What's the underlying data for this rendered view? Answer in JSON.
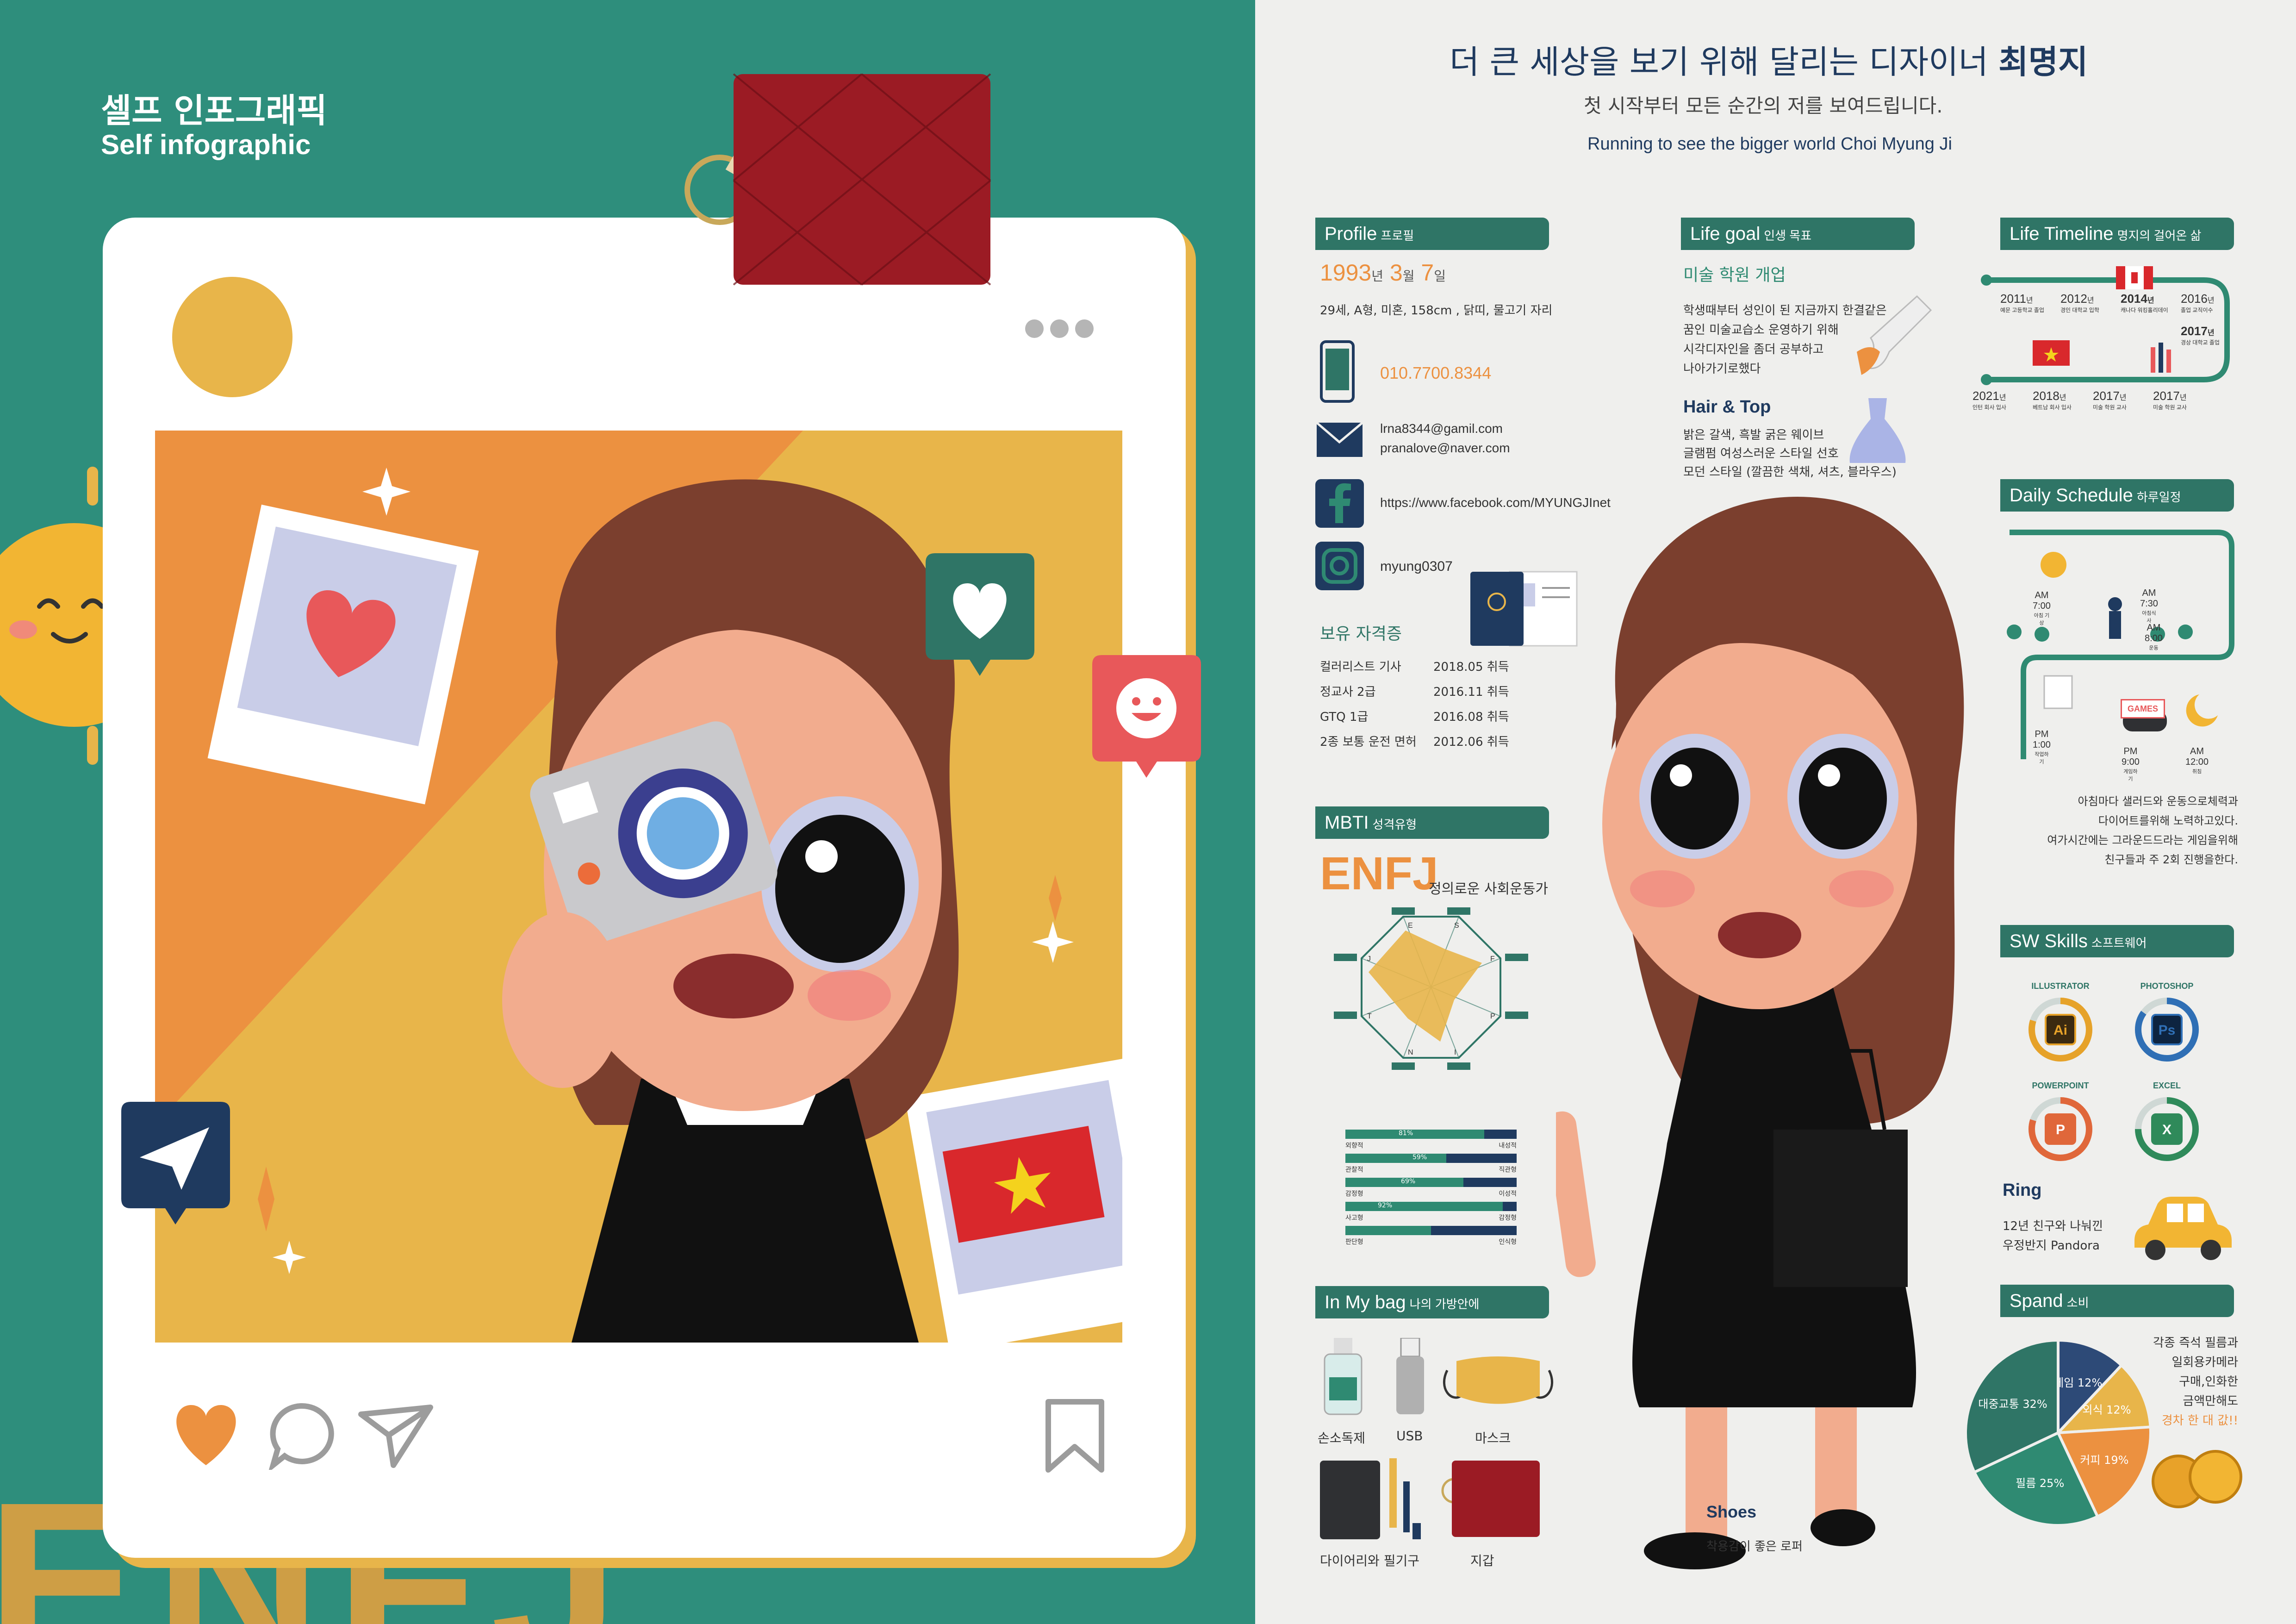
{
  "left": {
    "title_ko": "셀프 인포그래픽",
    "title_en": "Self infographic",
    "bg_text": "ENFJ"
  },
  "header": {
    "title_main": "더 큰 세상을 보기 위해 달리는 디자이너",
    "title_name": "최명지",
    "subtitle_ko": "첫 시작부터 모든 순간의 저를 보여드립니다.",
    "subtitle_en": "Running to see the bigger world Choi Myung Ji"
  },
  "profile": {
    "heading": "Profile",
    "heading_sub": "프로필",
    "birth": {
      "year": "1993",
      "year_unit": "년",
      "month": "3",
      "month_unit": "월",
      "day": "7",
      "day_unit": "일"
    },
    "details": "29세, A형, 미혼, 158cm , 닭띠, 물고기 자리",
    "phone": "010.7700.8344",
    "email1": "lrna8344@gamil.com",
    "email2": "pranalove@naver.com",
    "facebook": "https://www.facebook.com/MYUNGJInet",
    "instagram": "myung0307",
    "cert_heading": "보유 자격증",
    "certs": [
      {
        "name": "컬러리스트 기사",
        "date": "2018.05 취득"
      },
      {
        "name": "정교사 2급",
        "date": "2016.11 취득"
      },
      {
        "name": "GTQ 1급",
        "date": "2016.08 취득"
      },
      {
        "name": "2종 보통 운전 면허",
        "date": "2012.06 취득"
      }
    ]
  },
  "mbti": {
    "heading": "MBTI",
    "heading_sub": "성격유형",
    "type": "ENFJ",
    "desc": "정의로운 사회운동가",
    "radar_letters": [
      "E",
      "S",
      "F",
      "P",
      "I",
      "N",
      "T",
      "J"
    ],
    "bars": [
      {
        "left": "외향적",
        "right": "내성적",
        "pct": "81%",
        "value": 81
      },
      {
        "left": "관찰적",
        "right": "직관형",
        "pct": "59%",
        "value": 59
      },
      {
        "left": "감정형",
        "right": "이성적",
        "pct": "69%",
        "value": 69
      },
      {
        "left": "사고형",
        "right": "감정형",
        "pct": "92%",
        "value": 92
      },
      {
        "left": "판단형",
        "right": "인식형",
        "pct": "",
        "value": 50
      }
    ]
  },
  "bag": {
    "heading": "In My bag",
    "heading_sub": "나의 가방안에",
    "items": [
      "손소독제",
      "USB",
      "마스크",
      "다이어리와 필기구",
      "지갑"
    ]
  },
  "life_goal": {
    "heading": "Life goal",
    "heading_sub": "인생 목표",
    "goal_title": "미술 학원 개업",
    "goal_lines": [
      "학생때부터 성인이 된 지금까지 한결같은",
      "꿈인 미술교습소 운영하기 위해",
      "시각디자인을 좀더 공부하고",
      "나아가기로했다"
    ],
    "hair_title": "Hair & Top",
    "hair_lines": [
      "밝은 갈색, 흑발 굵은 웨이브",
      "글램펌 여성스러운 스타일 선호",
      "모던 스타일 (깔끔한 색채, 셔츠, 블라우스)"
    ],
    "shoes_title": "Shoes",
    "shoes_desc": "착용감이 좋은 로퍼"
  },
  "timeline": {
    "heading": "Life Timeline",
    "heading_sub": "명지의 걸어온 삶",
    "row1": [
      {
        "year": "2011",
        "unit": "년",
        "desc": "예문 고등학교 졸업"
      },
      {
        "year": "2012",
        "unit": "년",
        "desc": "경인 대학교 입학"
      },
      {
        "year": "2014",
        "unit": "년",
        "desc": "캐나다 워킹홀리데이"
      },
      {
        "year": "2016",
        "unit": "년",
        "desc": "졸업 교직이수"
      }
    ],
    "mid": {
      "year": "2017",
      "unit": "년",
      "desc": "경상 대학교 졸업"
    },
    "row2": [
      {
        "year": "2021",
        "unit": "년",
        "desc": "인턴 회사 입사"
      },
      {
        "year": "2018",
        "unit": "년",
        "desc": "베트남 회사 입사"
      },
      {
        "year": "2017",
        "unit": "년",
        "desc": "미술 학원 교사"
      },
      {
        "year": "2017",
        "unit": "년",
        "desc": "미술 학원 교사"
      }
    ]
  },
  "schedule": {
    "heading": "Daily Schedule",
    "heading_sub": "하루일정",
    "items": [
      {
        "time": "AM 7:00",
        "desc": "아침 기상"
      },
      {
        "time": "AM 7:30",
        "desc": "아침식사"
      },
      {
        "time": "AM 8:00",
        "desc": "운동"
      },
      {
        "time": "PM 1:00",
        "desc": "작업하기"
      },
      {
        "time": "PM 9:00",
        "desc": "게임하기"
      },
      {
        "time": "AM 12:00",
        "desc": "취침"
      }
    ],
    "games_label": "GAMES",
    "desc_lines": [
      "아침마다 샐러드와 운동으로체력과",
      "다이어트를위해 노력하고있다.",
      "여가시간에는 그라운드드라는 게임을위해",
      "친구들과 주 2회 진행을한다."
    ]
  },
  "sw": {
    "heading": "SW Skills",
    "heading_sub": "소프트웨어",
    "skills": [
      {
        "name": "ILLUSTRATOR",
        "abbr": "Ai",
        "color": "#e6a229",
        "bg": "#3b2a10",
        "level": 0.8
      },
      {
        "name": "PHOTOSHOP",
        "abbr": "Ps",
        "color": "#2f6fb5",
        "bg": "#0d2440",
        "level": 0.85
      },
      {
        "name": "POWERPOINT",
        "abbr": "P",
        "color": "#e0673a",
        "bg": "#e0673a",
        "level": 0.8
      },
      {
        "name": "EXCEL",
        "abbr": "X",
        "color": "#2f8a5a",
        "bg": "#2f8a5a",
        "level": 0.75
      }
    ]
  },
  "ring": {
    "title": "Ring",
    "lines": [
      "12년 친구와 나눠낀",
      "우정반지 Pandora"
    ]
  },
  "spend": {
    "heading": "Spand",
    "heading_sub": "소비",
    "slices": [
      {
        "label": "게임",
        "value": 12,
        "color": "#2d4a77"
      },
      {
        "label": "외식",
        "value": 12,
        "color": "#e8b54a"
      },
      {
        "label": "커피",
        "value": 19,
        "color": "#ec9140"
      },
      {
        "label": "필름",
        "value": 25,
        "color": "#2f8a72"
      },
      {
        "label": "대중교통",
        "value": 32,
        "color": "#2f7566"
      }
    ],
    "unit": "%",
    "desc_lines": [
      "각종 즉석 필름과",
      "일회용카메라",
      "구매,인화한",
      "금액만해도"
    ],
    "desc_highlight": "경차 한 대 값!!"
  },
  "colors": {
    "teal": "#2e8e7c",
    "dark_teal": "#2f7566",
    "orange": "#ec9140",
    "navy": "#1f3a5f",
    "hair": "#7b3f2e",
    "skin": "#f2ac8e"
  }
}
